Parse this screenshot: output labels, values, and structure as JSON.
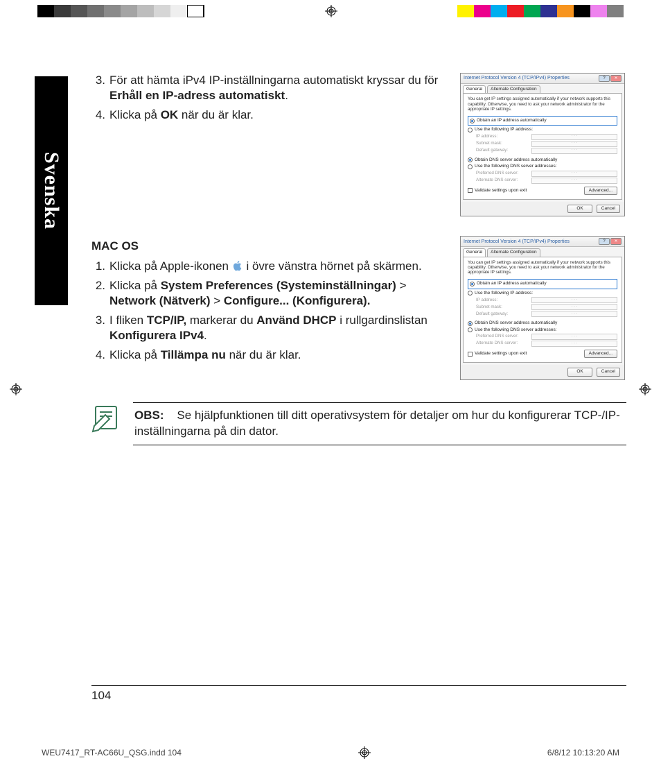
{
  "language_tab": "Svenska",
  "section1": {
    "items": [
      {
        "num": "3.",
        "pre": "För att hämta iPv4 IP-inställningarna automatiskt kryssar du för ",
        "bold": "Erhåll en IP-adress automatiskt",
        "post": "."
      },
      {
        "num": "4.",
        "pre": "Klicka på ",
        "bold": "OK",
        "post": "  när du är klar."
      }
    ]
  },
  "mac_heading": "MAC OS",
  "section2": {
    "items": [
      {
        "num": "1.",
        "parts": [
          "Klicka på Apple-ikonen ",
          " i övre vänstra hörnet på skärmen."
        ]
      },
      {
        "num": "2.",
        "rich": [
          {
            "t": "Klicka på "
          },
          {
            "t": "System Preferences (Systeminställningar)",
            "b": true
          },
          {
            "t": " > "
          },
          {
            "t": "Network (Nätverk)",
            "b": true
          },
          {
            "t": " > "
          },
          {
            "t": "Configure... (Konfigurera).",
            "b": true
          }
        ]
      },
      {
        "num": "3.",
        "rich": [
          {
            "t": "I fliken "
          },
          {
            "t": "TCP/IP,",
            "b": true
          },
          {
            "t": " markerar du "
          },
          {
            "t": "Använd DHCP",
            "b": true
          },
          {
            "t": " i rullgardinslistan "
          },
          {
            "t": "Konfigurera IPv4",
            "b": true
          },
          {
            "t": "."
          }
        ]
      },
      {
        "num": "4.",
        "rich": [
          {
            "t": "Klicka på "
          },
          {
            "t": "Tillämpa nu",
            "b": true
          },
          {
            "t": " när du är klar."
          }
        ]
      }
    ]
  },
  "note": {
    "label": "OBS:",
    "text": "Se hjälpfunktionen till ditt operativsystem för detaljer om hur du konfigurerar TCP-/IP-inställningarna på din dator."
  },
  "page_number": "104",
  "footer": {
    "file": "WEU7417_RT-AC66U_QSG.indd   104",
    "date": "6/8/12   10:13:20 AM"
  },
  "dialog": {
    "title": "Internet Protocol Version 4 (TCP/IPv4) Properties",
    "tabs": [
      "General",
      "Alternate Configuration"
    ],
    "hint": "You can get IP settings assigned automatically if your network supports this capability. Otherwise, you need to ask your network administrator for the appropriate IP settings.",
    "opt_ip_auto": "Obtain an IP address automatically",
    "opt_ip_manual": "Use the following IP address:",
    "lbl_ip": "IP address:",
    "lbl_mask": "Subnet mask:",
    "lbl_gw": "Default gateway:",
    "opt_dns_auto": "Obtain DNS server address automatically",
    "opt_dns_manual": "Use the following DNS server addresses:",
    "lbl_dns1": "Preferred DNS server:",
    "lbl_dns2": "Alternate DNS server:",
    "chk_validate": "Validate settings upon exit",
    "btn_adv": "Advanced...",
    "btn_ok": "OK",
    "btn_cancel": "Cancel"
  },
  "printer_colors_left": [
    "#000000",
    "#3a3a3a",
    "#555555",
    "#707070",
    "#8a8a8a",
    "#a4a4a4",
    "#bdbdbd",
    "#d6d6d6",
    "#efefef",
    "#ffffff"
  ],
  "printer_colors_right": [
    "#fff200",
    "#ec008c",
    "#00aeef",
    "#ed1c24",
    "#00a651",
    "#2e3192",
    "#f7941e",
    "#000000",
    "#ee82ee",
    "#808080"
  ]
}
